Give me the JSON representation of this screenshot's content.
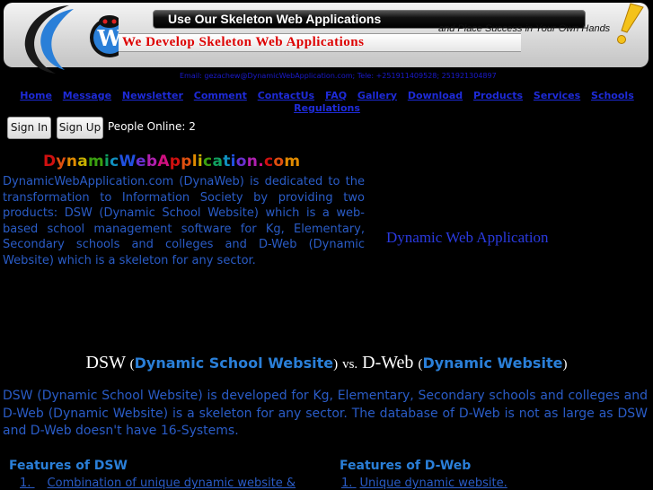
{
  "banner": {
    "slogan": "Use Our Skeleton Web Applications",
    "tagline": "and Place Success in Your Own Hands",
    "headline": "We Develop Skeleton Web Applications",
    "contact": "Email: gezachew@DynamicWebApplication.com; Tele: +251911409528; 251921304897"
  },
  "nav": {
    "items": [
      "Home",
      "Message",
      "Newsletter",
      "Comment",
      "ContactUs",
      "FAQ",
      "Gallery",
      "Download",
      "Products",
      "Services",
      "Schools",
      "Regulations"
    ]
  },
  "auth": {
    "sign_in": "Sign In",
    "sign_up": "Sign Up",
    "online_label": "People Online:",
    "online_count": "2"
  },
  "brand": {
    "letters": [
      "D",
      "y",
      "n",
      "a",
      "m",
      "i",
      "c",
      "W",
      "e",
      "b",
      "A",
      "p",
      "p",
      "l",
      "i",
      "c",
      "a",
      "t",
      "i",
      "o",
      "n",
      ".",
      "c",
      "o",
      "m"
    ],
    "colors": [
      "#d01010",
      "#e05010",
      "#e08a00",
      "#c8b000",
      "#3aa010",
      "#10a060",
      "#1090c0",
      "#2050e0",
      "#6a30d0",
      "#b020b0",
      "#d01080",
      "#d01010",
      "#e05010",
      "#e08a00",
      "#c8b000",
      "#3aa010",
      "#10a060",
      "#1090c0",
      "#2050e0",
      "#6a30d0",
      "#b020b0",
      "#d01080",
      "#d01010",
      "#e05010",
      "#e08a00"
    ]
  },
  "intro": "DynamicWebApplication.com (DynaWeb) is dedicated to the transformation to Information Society by providing two products: DSW (Dynamic School Website) which is a web-based school management software for Kg, Elementary, Secondary schools and colleges and D-Web (Dynamic Website) which is a skeleton for any sector.",
  "side_title": "Dynamic Web Application",
  "comparison": {
    "dsw": "DSW",
    "dsw_full": "Dynamic School Website",
    "vs": "vs.",
    "dweb": "D-Web",
    "dweb_full": "Dynamic Website",
    "description": "DSW (Dynamic School Website) is developed for Kg, Elementary, Secondary schools and colleges and D-Web (Dynamic Website) is a skeleton for any sector.  The database of D-Web is not as large as DSW and D-Web doesn't have 16-Systems."
  },
  "features": {
    "dsw_heading": "Features of DSW",
    "dsw_first_num": "1.",
    "dsw_first": "Combination of unique dynamic website &",
    "dweb_heading": "Features of D-Web",
    "dweb_first_num": "1.",
    "dweb_first": "Unique dynamic website."
  }
}
